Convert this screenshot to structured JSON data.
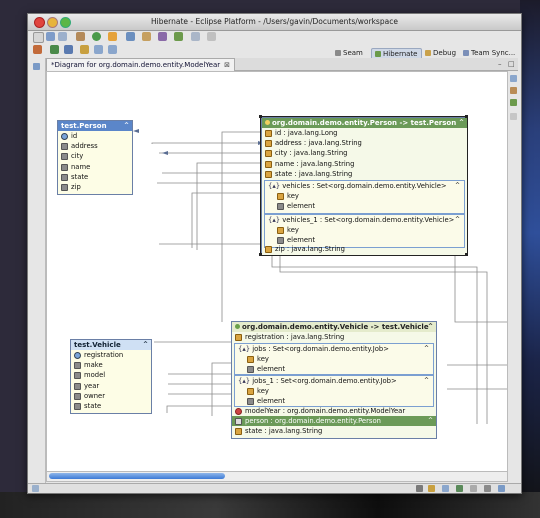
{
  "window": {
    "title": "Hibernate - Eclipse Platform - /Users/gavin/Documents/workspace"
  },
  "perspectives": [
    {
      "label": "Seam",
      "active": false
    },
    {
      "label": "Hibernate",
      "active": true
    },
    {
      "label": "Debug",
      "active": false
    },
    {
      "label": "Team Sync...",
      "active": false
    }
  ],
  "editor": {
    "tab_label": "*Diagram for org.domain.demo.entity.ModelYear",
    "tab_close": "⊠"
  },
  "tables": {
    "person": {
      "name": "test.Person",
      "columns": [
        "id",
        "address",
        "city",
        "name",
        "state",
        "zip"
      ]
    },
    "vehicle": {
      "name": "test.Vehicle",
      "columns": [
        "registration",
        "make",
        "model",
        "year",
        "owner",
        "state"
      ]
    }
  },
  "entities": {
    "person": {
      "header": "org.domain.demo.entity.Person -> test.Person",
      "props": [
        "id : java.lang.Long",
        "address : java.lang.String",
        "city : java.lang.String",
        "name : java.lang.String",
        "state : java.lang.String"
      ],
      "vehicles": {
        "label": "vehicles : Set<org.domain.demo.entity.Vehicle>",
        "key": "key",
        "element": "element"
      },
      "vehicles_1": {
        "label": "vehicles_1 : Set<org.domain.demo.entity.Vehicle>",
        "key": "key",
        "element": "element"
      },
      "zip": "zip : java.lang.String"
    },
    "vehicle": {
      "header": "org.domain.demo.entity.Vehicle -> test.Vehicle",
      "registration": "registration : java.lang.String",
      "jobs": {
        "label": "jobs : Set<org.domain.demo.entity.Job>",
        "key": "key",
        "element": "element"
      },
      "jobs_1": {
        "label": "jobs_1 : Set<org.domain.demo.entity.Job>",
        "key": "key",
        "element": "element"
      },
      "modelyear": "modelYear : org.domain.demo.entity.ModelYear",
      "person": "person : org.domain.demo.entity.Person",
      "state": "state : java.lang.String"
    }
  },
  "colors": {
    "selected_header": "#5b86c9",
    "entity_header": "#6b9a58",
    "accent_blue": "#3c7ad6"
  }
}
